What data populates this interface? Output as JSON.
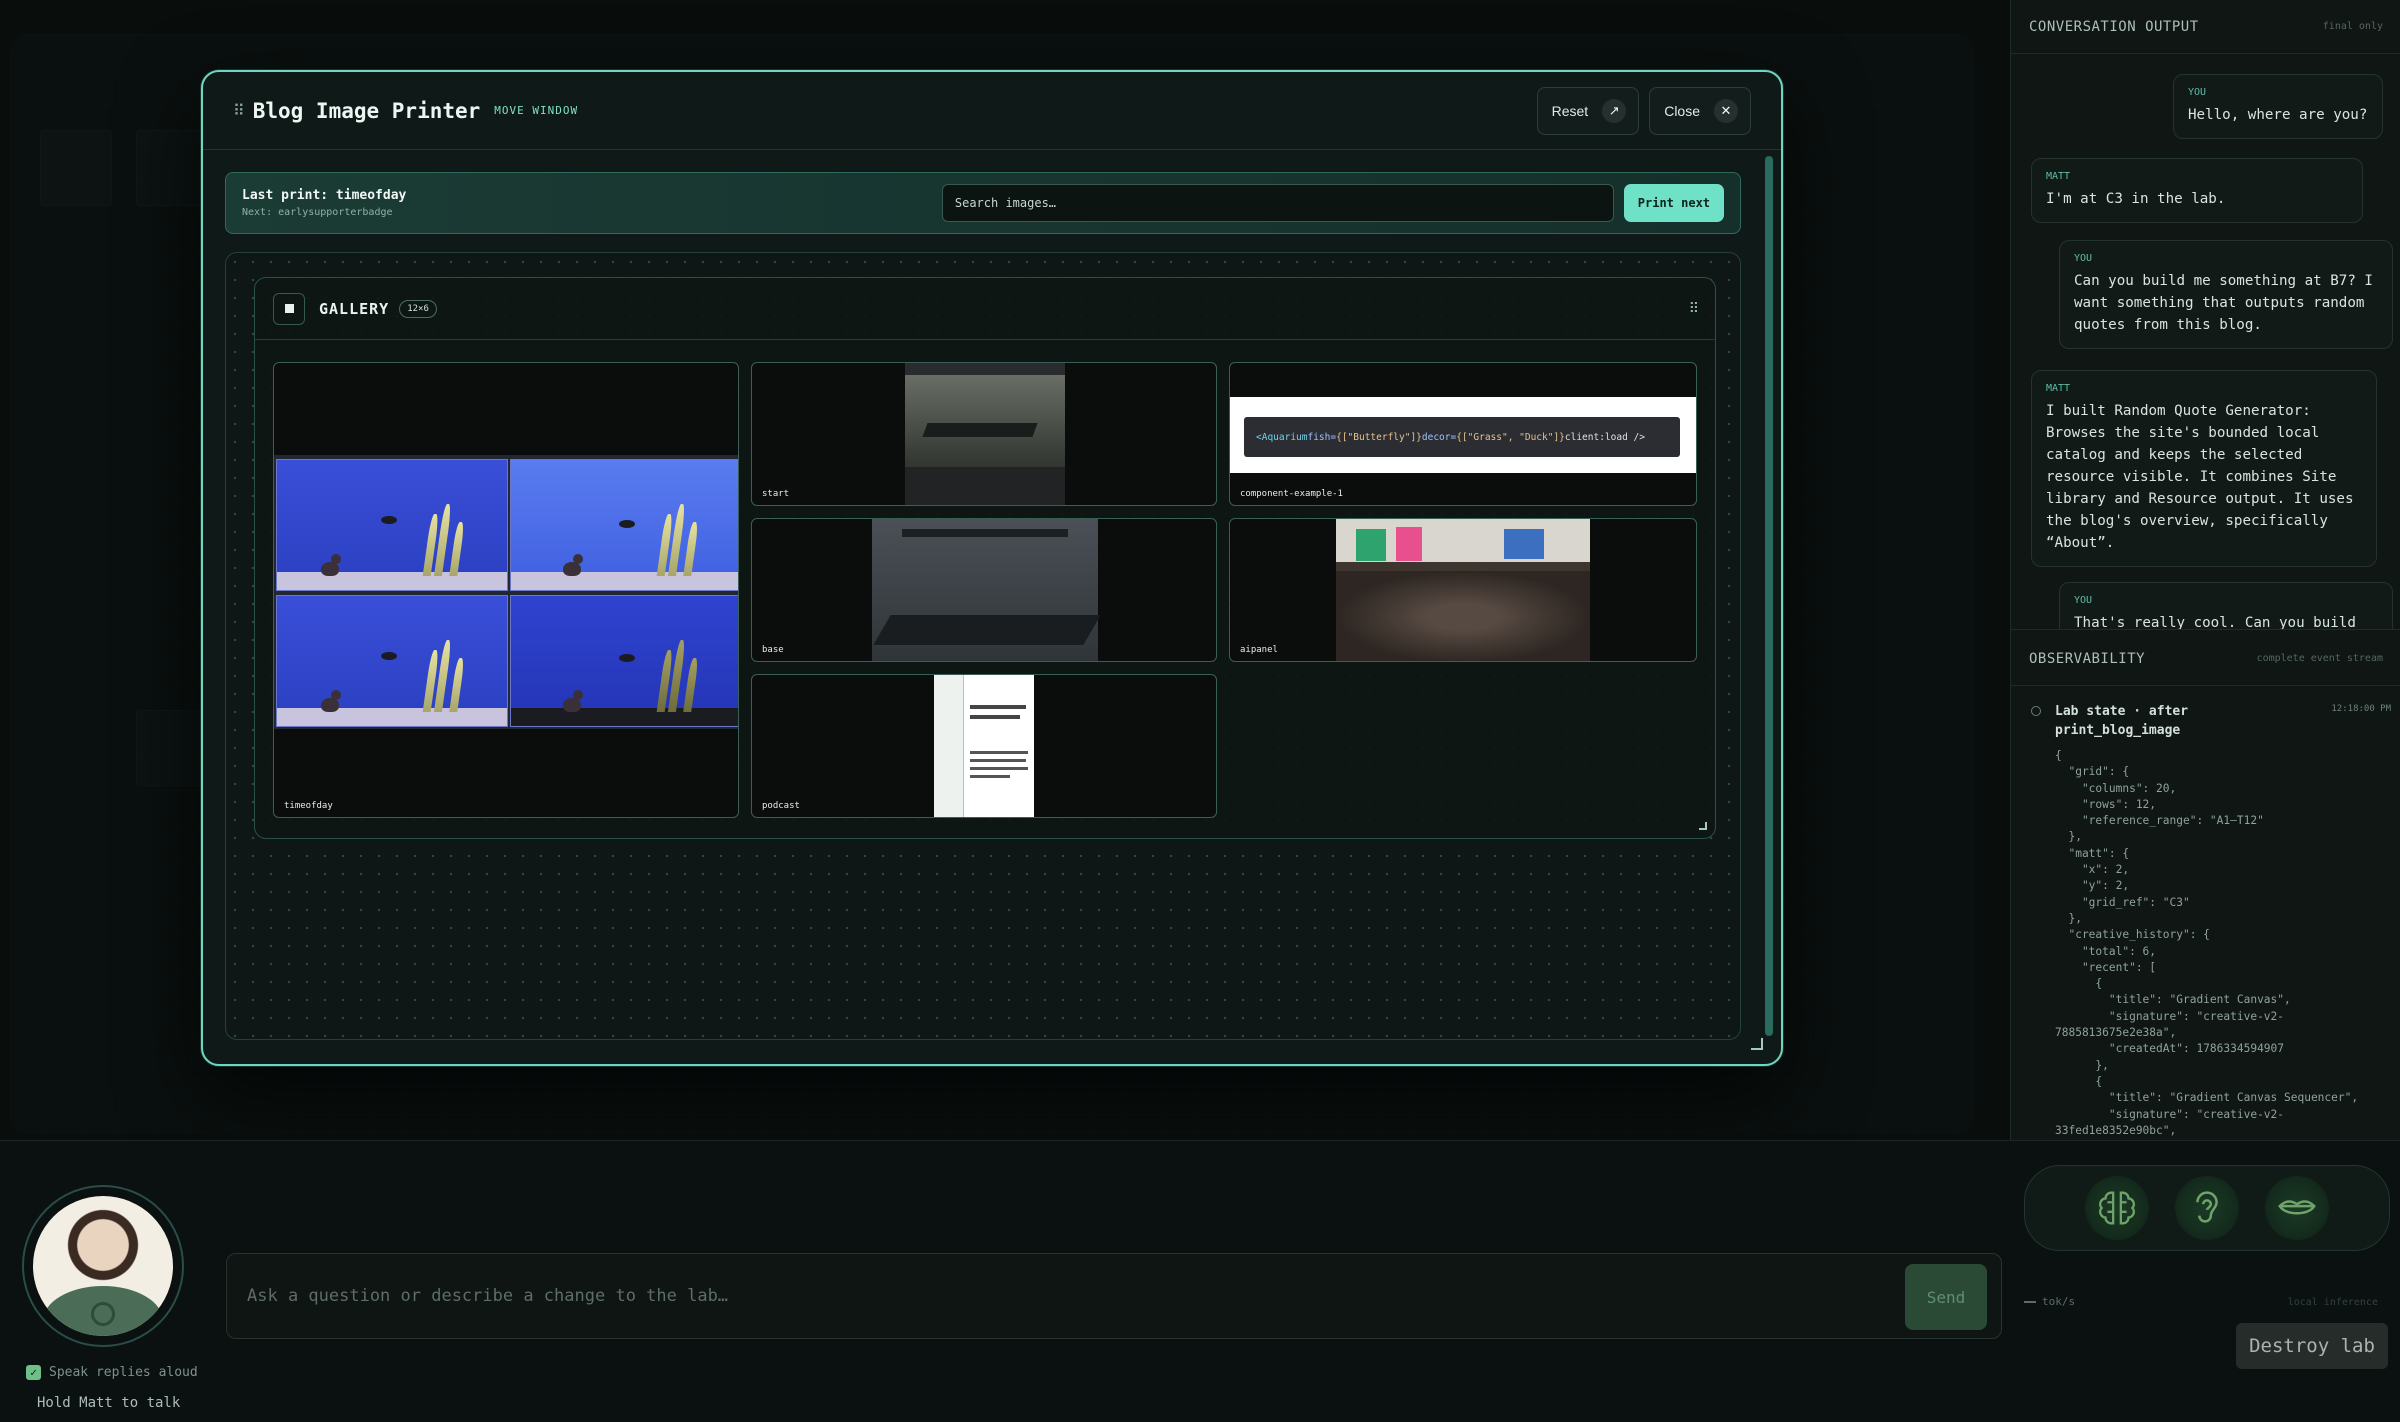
{
  "window": {
    "title": "Blog Image Printer",
    "move_hint": "MOVE WINDOW",
    "reset_label": "Reset",
    "close_label": "Close"
  },
  "print_bar": {
    "last_print": "Last print: timeofday",
    "next": "Next: earlysupporterbadge",
    "search_placeholder": "Search images…",
    "print_next_label": "Print next"
  },
  "gallery": {
    "title": "GALLERY",
    "size_badge": "12×6",
    "tiles": [
      {
        "label": "timeofday"
      },
      {
        "label": "start"
      },
      {
        "label": "component-example-1"
      },
      {
        "label": "base"
      },
      {
        "label": "aipanel"
      },
      {
        "label": "podcast"
      }
    ],
    "code_snippet": {
      "tag": "<Aquarium",
      "attr1": " fish=",
      "val1": "{[\"Butterfly\"]}",
      "attr2": " decor=",
      "val2": "{[\"Grass\", \"Duck\"]}",
      "tail": " client:load />"
    }
  },
  "conversation": {
    "title": "CONVERSATION OUTPUT",
    "aside": "final only",
    "messages": [
      {
        "who": "YOU",
        "text": "Hello, where are you?"
      },
      {
        "who": "MATT",
        "text": "I'm at C3 in the lab."
      },
      {
        "who": "YOU",
        "text": "Can you build me something at B7? I want something that outputs random quotes from this blog."
      },
      {
        "who": "MATT",
        "text": "I built Random Quote Generator: Browses the site's bounded local catalog and keeps the selected resource visible. It combines Site library and Resource output. It uses the blog's overview, specifically “About”."
      },
      {
        "who": "YOU",
        "text": "That's really cool. Can you build"
      }
    ]
  },
  "observability": {
    "title": "OBSERVABILITY",
    "aside": "complete event stream",
    "event_title": "Lab state · after print_blog_image",
    "event_time": "12:18:00 PM",
    "json": "{\n  \"grid\": {\n    \"columns\": 20,\n    \"rows\": 12,\n    \"reference_range\": \"A1–T12\"\n  },\n  \"matt\": {\n    \"x\": 2,\n    \"y\": 2,\n    \"grid_ref\": \"C3\"\n  },\n  \"creative_history\": {\n    \"total\": 6,\n    \"recent\": [\n      {\n        \"title\": \"Gradient Canvas\",\n        \"signature\": \"creative-v2-\n7885813675e2e38a\",\n        \"createdAt\": 1786334594907\n      },\n      {\n        \"title\": \"Gradient Canvas Sequencer\",\n        \"signature\": \"creative-v2-\n33fed1e8352e90bc\","
  },
  "bottom": {
    "speak_label": "Speak replies aloud",
    "hold_label": "Hold Matt to talk",
    "chat_placeholder": "Ask a question or describe a change to the lab…",
    "send_label": "Send",
    "tokrate": "tok/s",
    "local_label": "local inference",
    "destroy_label": "Destroy lab"
  },
  "colors": {
    "accent": "#6fe1c6",
    "border_accent": "#6fd6c0",
    "background": "#0b100f"
  },
  "icons": {
    "senses": [
      "brain-icon",
      "ear-icon",
      "mouth-icon"
    ]
  }
}
